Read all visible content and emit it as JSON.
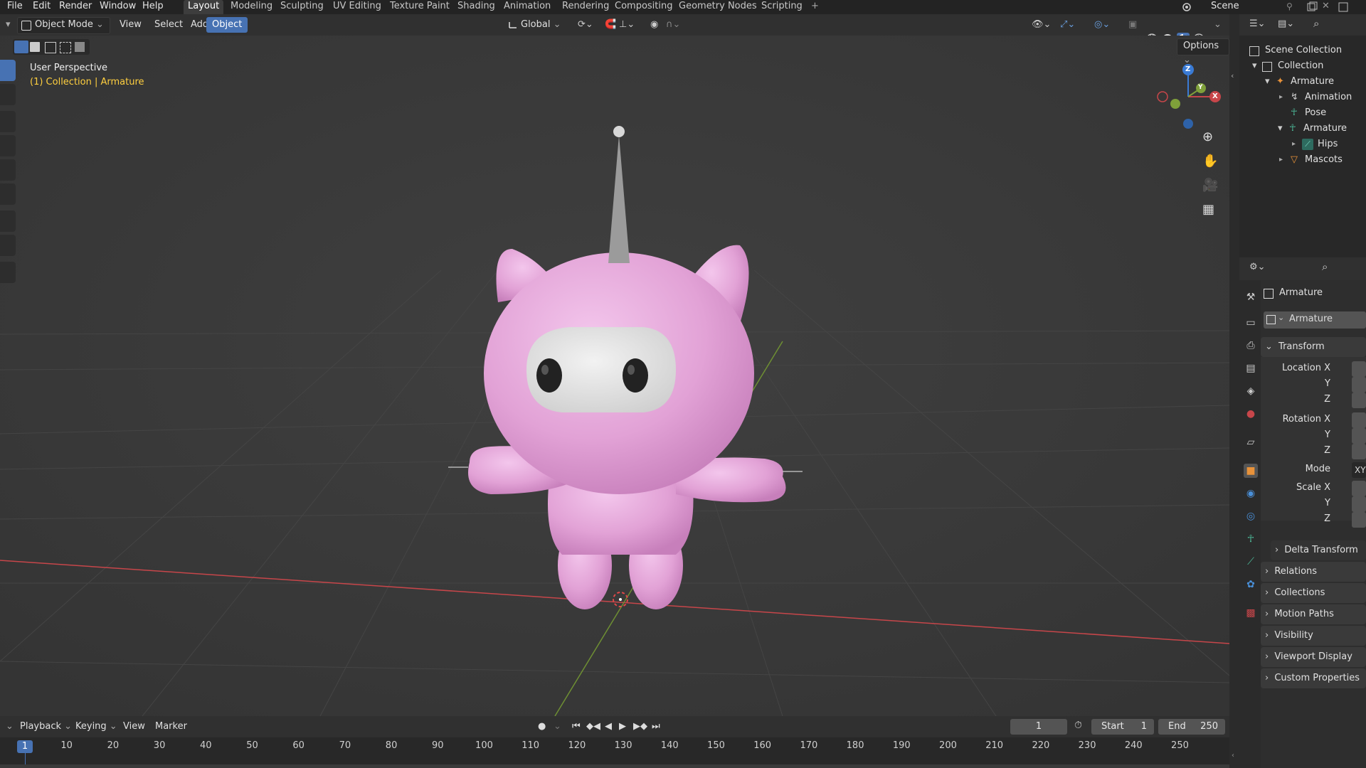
{
  "menus": [
    "File",
    "Edit",
    "Render",
    "Window",
    "Help"
  ],
  "workspaces": [
    "Layout",
    "Modeling",
    "Sculpting",
    "UV Editing",
    "Texture Paint",
    "Shading",
    "Animation",
    "Rendering",
    "Compositing",
    "Geometry Nodes",
    "Scripting"
  ],
  "active_workspace": "Layout",
  "scene_name": "Scene",
  "viewport_header": {
    "mode": "Object Mode",
    "menus": [
      "View",
      "Select",
      "Add",
      "Object"
    ],
    "active_menu": "Object",
    "transform_orientation": "Global",
    "options_label": "Options"
  },
  "viewport": {
    "view_name": "User Perspective",
    "collection_info": "(1) Collection | Armature",
    "gizmo_axes": {
      "x": "X",
      "y": "Y",
      "z": "Z"
    }
  },
  "outliner": {
    "items": [
      {
        "label": "Scene Collection"
      },
      {
        "label": "Collection"
      },
      {
        "label": "Armature"
      },
      {
        "label": "Animation"
      },
      {
        "label": "Pose"
      },
      {
        "label": "Armature"
      },
      {
        "label": "Hips"
      },
      {
        "label": "Mascots"
      }
    ]
  },
  "properties": {
    "object_name": "Armature",
    "data_name": "Armature",
    "transform_label": "Transform",
    "location_label": "Location X",
    "rotation_label": "Rotation X",
    "mode_label": "Mode",
    "mode_value": "XY",
    "scale_label": "Scale X",
    "y_label": "Y",
    "z_label": "Z",
    "delta_transform": "Delta Transform",
    "panels": [
      "Relations",
      "Collections",
      "Motion Paths",
      "Visibility",
      "Viewport Display",
      "Custom Properties"
    ]
  },
  "timeline": {
    "menus": [
      "Playback",
      "Keying",
      "View",
      "Marker"
    ],
    "current_frame": "1",
    "start_label": "Start",
    "start_value": "1",
    "end_label": "End",
    "end_value": "250",
    "playhead_label": "1",
    "ticks": [
      "10",
      "20",
      "30",
      "40",
      "50",
      "60",
      "70",
      "80",
      "90",
      "100",
      "110",
      "120",
      "130",
      "140",
      "150",
      "160",
      "170",
      "180",
      "190",
      "200",
      "210",
      "220",
      "230",
      "240",
      "250"
    ]
  },
  "colors": {
    "accent": "#4772b3",
    "mascot_pink": "#e7a9dc",
    "x_axis": "#c7464a",
    "y_axis": "#7fa03a",
    "z_axis": "#3a7bd5",
    "active_text": "#ffcf3f"
  }
}
